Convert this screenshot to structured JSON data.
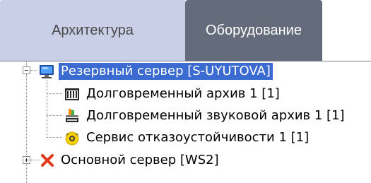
{
  "tabs": [
    {
      "label": "Архитектура"
    },
    {
      "label": "Оборудование"
    }
  ],
  "tree": {
    "server_reserve": {
      "label": "Резервный сервер [S-UYUTOVA]",
      "icon": "monitor-icon",
      "expanded": true,
      "selected": true
    },
    "children": [
      {
        "label": "Долговременный архив 1 [1]",
        "icon": "archive-icon"
      },
      {
        "label": "Долговременный звуковой архив 1 [1]",
        "icon": "audio-archive-icon"
      },
      {
        "label": "Сервис отказоустойчивости 1 [1]",
        "icon": "failover-service-icon"
      }
    ],
    "server_main": {
      "label": "Основной сервер [WS2]",
      "icon": "red-x-icon",
      "expanded": false
    }
  },
  "colors": {
    "selection": "#3b6bd1",
    "active_tab": "#646b7b",
    "inactive_tab": "#c9cfe6",
    "error_x": "#e23a1a"
  }
}
